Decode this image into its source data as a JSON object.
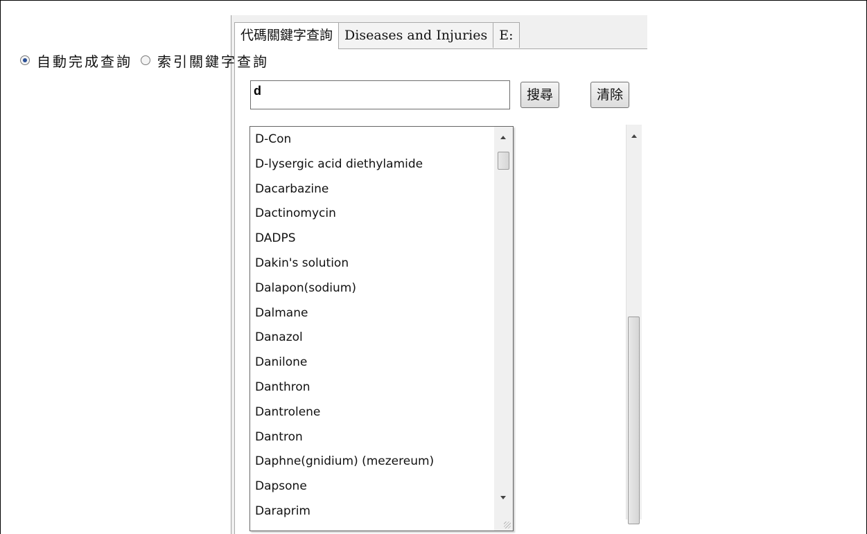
{
  "tabs": [
    {
      "label": "代碼關鍵字查詢"
    },
    {
      "label": "Diseases and Injuries"
    },
    {
      "label": "E:"
    }
  ],
  "search_mode": {
    "options": [
      {
        "label": "自動完成查詢",
        "checked": true
      },
      {
        "label": "索引關鍵字查詢",
        "checked": false
      }
    ]
  },
  "search": {
    "value": "d",
    "search_button": "搜尋",
    "clear_button": "清除"
  },
  "autocomplete": {
    "items": [
      "D-Con",
      "D-lysergic acid diethylamide",
      "Dacarbazine",
      "Dactinomycin",
      "DADPS",
      "Dakin's solution",
      "Dalapon(sodium)",
      "Dalmane",
      "Danazol",
      "Danilone",
      "Danthron",
      "Dantrolene",
      "Dantron",
      "Daphne(gnidium) (mezereum)",
      "Dapsone",
      "Daraprim"
    ]
  },
  "icons": [
    "radio-selected-icon",
    "radio-unselected-icon",
    "scroll-up-arrow-icon",
    "scroll-down-arrow-icon",
    "resize-grip-icon"
  ]
}
